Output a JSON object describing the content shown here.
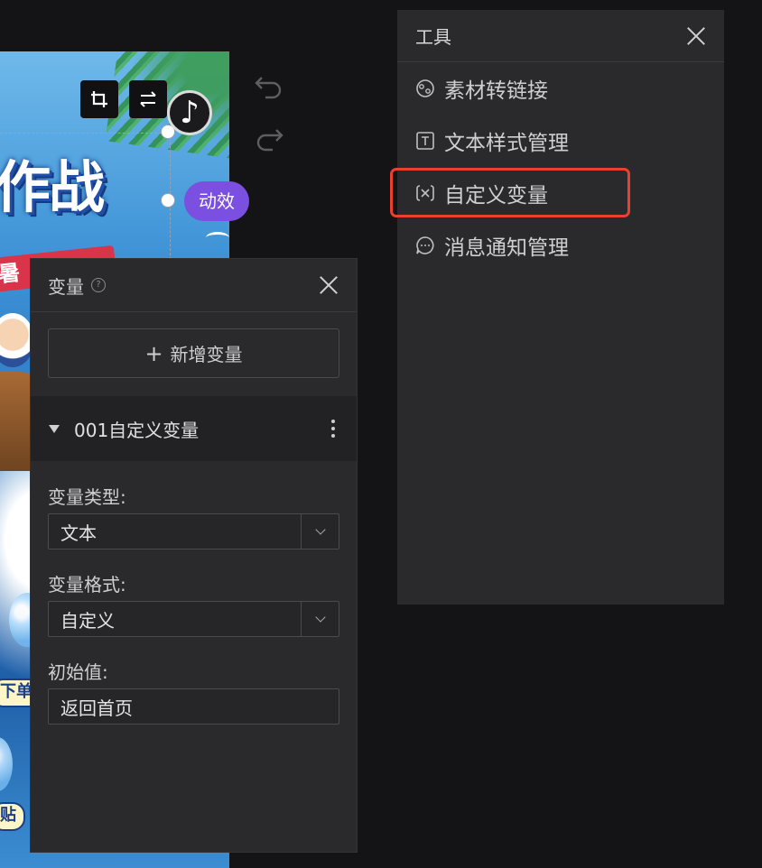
{
  "canvas": {
    "headline": "作战",
    "ribbon": "暑",
    "tag_1": "下单",
    "tag_2": "贴",
    "animation_badge": "动效",
    "music_symbol": "♪"
  },
  "tools_panel": {
    "title": "工具",
    "items": [
      {
        "label": "素材转链接",
        "icon": "material-link-icon"
      },
      {
        "label": "文本样式管理",
        "icon": "text-style-icon"
      },
      {
        "label": "自定义变量",
        "icon": "variable-icon"
      },
      {
        "label": "消息通知管理",
        "icon": "message-icon"
      }
    ],
    "highlighted_item": "自定义变量",
    "highlight_color": "#e8412e"
  },
  "variable_panel": {
    "title": "变量",
    "help_symbol": "?",
    "add_button": "新增变量",
    "variable_name": "001自定义变量",
    "type_label": "变量类型:",
    "type_value": "文本",
    "format_label": "变量格式:",
    "format_value": "自定义",
    "initial_label": "初始值:",
    "initial_value": "返回首页"
  },
  "colors": {
    "background": "#141416",
    "panel": "#2a2a2d",
    "accent_purple": "#7b4fe0"
  }
}
